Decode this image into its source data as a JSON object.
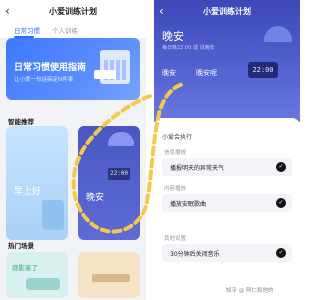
{
  "left": {
    "header": {
      "back_icon": "‹",
      "title": "小爱训练计划"
    },
    "tabs": [
      {
        "label": "日常习惯"
      },
      {
        "label": "个人训练"
      }
    ],
    "guide": {
      "title": "日常习惯使用指南",
      "subtitle": "让小爱一句话搞定N件事"
    },
    "smart_section": "智能推荐",
    "cards": [
      {
        "label": "早上好"
      },
      {
        "label": "晚安",
        "clock": "22:00"
      }
    ],
    "hot_section": "热门场景",
    "hot_cards": [
      {
        "label": "观影家了"
      }
    ]
  },
  "right": {
    "header": {
      "back_icon": "‹",
      "title": "小爱训练计划"
    },
    "hero": {
      "title": "晚安",
      "subtitle": "每日晚22:00 或 说晚安",
      "chips": [
        "晚安",
        "晚安呢"
      ],
      "clock": "22:00"
    },
    "exec_title": "小爱会执行",
    "sections": [
      {
        "title": "信息播报",
        "item": "播报明天的异常天气"
      },
      {
        "title": "内容播放",
        "item": "播放安眠歌曲"
      },
      {
        "title": "其他设置",
        "item": "30分钟后关闭音乐"
      }
    ],
    "check_icon": "✓",
    "watermark": "知乎 @ 阿仁和他的"
  },
  "colors": {
    "accent": "#2f6af5",
    "night": "#4a56c2",
    "highlight": "#f2c94c"
  }
}
